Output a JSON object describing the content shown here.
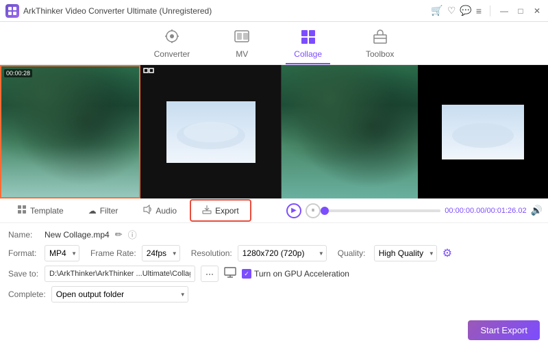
{
  "app": {
    "title": "ArkThinker Video Converter Ultimate (Unregistered)"
  },
  "nav": {
    "tabs": [
      {
        "id": "converter",
        "label": "Converter",
        "icon": "⊙",
        "active": false
      },
      {
        "id": "mv",
        "label": "MV",
        "icon": "🖼",
        "active": false
      },
      {
        "id": "collage",
        "label": "Collage",
        "icon": "⊞",
        "active": true
      },
      {
        "id": "toolbox",
        "label": "Toolbox",
        "icon": "🧰",
        "active": false
      }
    ]
  },
  "subtabs": {
    "tabs": [
      {
        "id": "template",
        "label": "Template",
        "icon": "⊞",
        "active": false
      },
      {
        "id": "filter",
        "label": "Filter",
        "icon": "☁",
        "active": false
      },
      {
        "id": "audio",
        "label": "Audio",
        "icon": "🔊",
        "active": false
      },
      {
        "id": "export",
        "label": "Export",
        "icon": "⬆",
        "active": true
      }
    ]
  },
  "collage": {
    "timestamp": "00:00:28",
    "left_video": "ocean_left",
    "right_video": "ocean_right"
  },
  "player": {
    "time_current": "00:00:00.00",
    "time_total": "00:01:26.02",
    "time_display": "00:00:00.00/00:01:26.02"
  },
  "settings": {
    "name_label": "Name:",
    "name_value": "New Collage.mp4",
    "format_label": "Format:",
    "format_value": "MP4",
    "framerate_label": "Frame Rate:",
    "framerate_value": "24fps",
    "resolution_label": "Resolution:",
    "resolution_value": "1280x720 (720p)",
    "quality_label": "Quality:",
    "quality_value": "High Quality",
    "saveto_label": "Save to:",
    "saveto_path": "D:\\ArkThinker\\ArkThinker ...Ultimate\\Collage Exported",
    "gpu_label": "Turn on GPU Acceleration",
    "complete_label": "Complete:",
    "complete_value": "Open output folder"
  },
  "buttons": {
    "start_export": "Start Export",
    "dots": "···"
  },
  "titlebar": {
    "icons": [
      "🛒",
      "♡",
      "💬",
      "≡",
      "—",
      "□",
      "×"
    ]
  }
}
